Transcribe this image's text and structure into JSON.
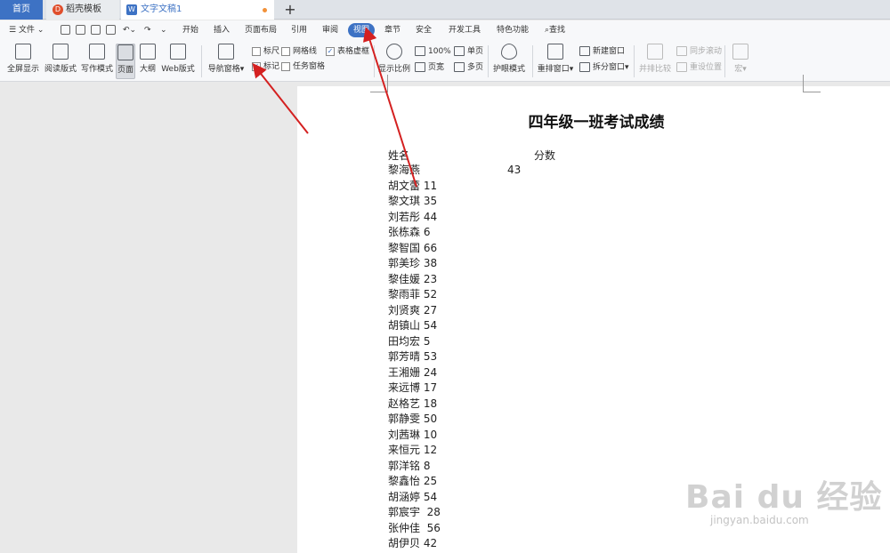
{
  "tabs": {
    "home": "首页",
    "template": "稻壳模板",
    "doc": "文字文稿1"
  },
  "menu": {
    "file": "文件",
    "items": [
      "开始",
      "插入",
      "页面布局",
      "引用",
      "审阅",
      "视图",
      "章节",
      "安全",
      "开发工具",
      "特色功能"
    ],
    "search": "查找",
    "active_index": 5
  },
  "ribbon": {
    "fullscreen": "全屏显示",
    "read_mode": "阅读版式",
    "write_mode": "写作模式",
    "page": "页面",
    "outline": "大纲",
    "web": "Web版式",
    "nav_pane": "导航窗格",
    "ruler": "标尺",
    "gridlines": "网格线",
    "table_gridlines": "表格虚框",
    "marks": "标记",
    "task_pane": "任务窗格",
    "zoom": "显示比例",
    "zoom_100": "100%",
    "single_page": "单页",
    "page_width": "页宽",
    "multi_page": "多页",
    "eye_mode": "护眼模式",
    "rearrange": "重排窗口",
    "new_window": "新建窗口",
    "split_window": "拆分窗口",
    "side_by_side": "并排比较",
    "sync_scroll": "同步滚动",
    "reset_position": "重设位置",
    "macro": "宏"
  },
  "document": {
    "title": "四年级一班考试成绩",
    "col_name": "姓名",
    "col_score": "分数",
    "first_score": "43",
    "rows": [
      "黎海燕",
      "胡文蕾 11",
      "黎文琪 35",
      "刘若彤 44",
      "张栋森 6",
      "黎智国 66",
      "郭美珍 38",
      "黎佳媛 23",
      "黎雨菲 52",
      "刘贤爽 27",
      "胡镇山 54",
      "田均宏 5",
      "郭芳晴 53",
      "王湘姗 24",
      "来远博 17",
      "赵格艺 18",
      "郭静雯 50",
      "刘茜琳 10",
      "来恒元 12",
      "郭洋铭 8",
      "黎鑫怡 25",
      "胡涵婷 54",
      "郭宸宇  28",
      "张仲佳  56",
      "胡伊贝 42"
    ]
  },
  "watermark": {
    "brand": "Bai du 经验",
    "url": "jingyan.baidu.com"
  },
  "colors": {
    "accent": "#3d72c4",
    "arrow": "#d42020"
  }
}
